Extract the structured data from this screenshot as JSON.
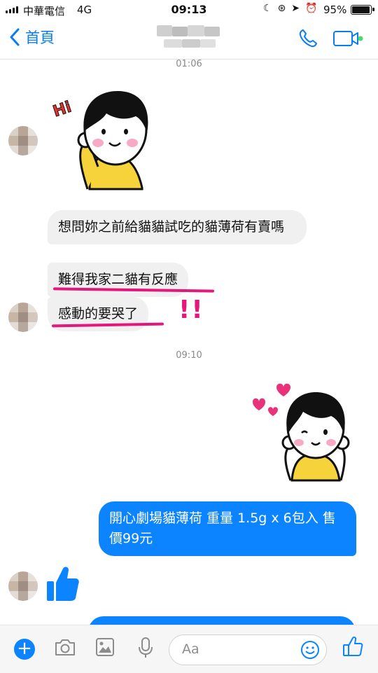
{
  "status_bar": {
    "carrier": "中華電信",
    "network": "4G",
    "time": "09:13",
    "battery": "95%"
  },
  "nav": {
    "back_label": "首頁",
    "icons": [
      "phone-icon",
      "video-call-icon"
    ],
    "accent": "#0a7cf2",
    "active_dot": "#4cd964"
  },
  "messages": {
    "timestamp_1": "01:06",
    "sticker_1_text": "Hi",
    "bubble_1": "想問妳之前給貓貓試吃的貓薄荷有賣嗎",
    "bubble_2": "難得我家二貓有反應",
    "bubble_3": "感動的要哭了",
    "exclaim": "!!",
    "timestamp_2": "09:10",
    "bubble_4": "開心劇場貓薄荷 重量 1.5g x 6包入 售價99元"
  },
  "composer": {
    "placeholder": "Aa",
    "icons": [
      "add-icon",
      "camera-icon",
      "image-icon",
      "mic-icon",
      "emoji-icon",
      "thumbs-up-icon"
    ]
  },
  "colors": {
    "outgoing": "#0c84ff",
    "incoming": "#f1f0f0",
    "annotation": "#e4177d"
  }
}
